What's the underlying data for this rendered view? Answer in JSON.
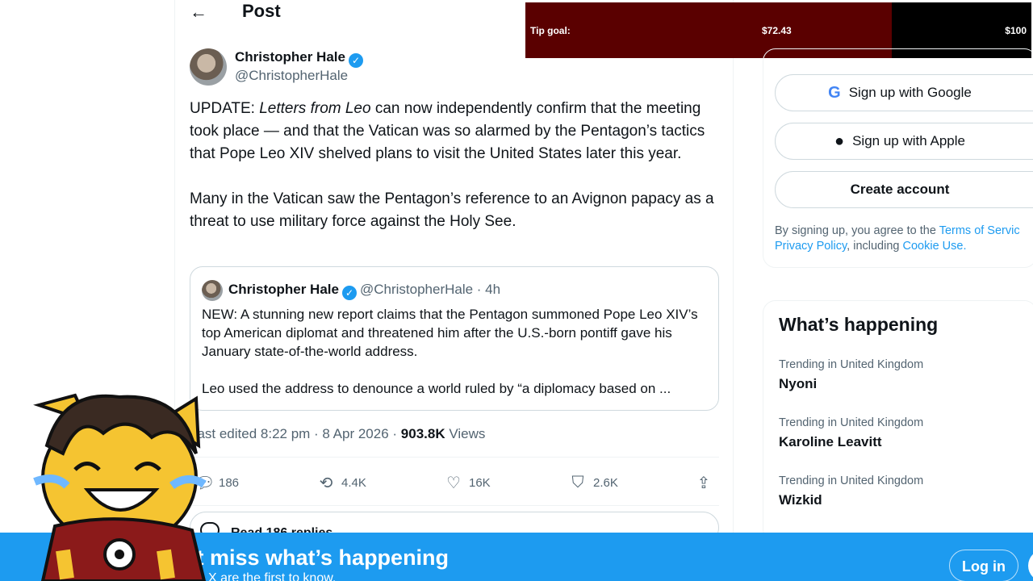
{
  "header": {
    "title": "Post",
    "back_icon": "arrow-left-icon"
  },
  "post": {
    "author_name": "Christopher Hale",
    "author_handle": "@ChristopherHale",
    "text_p1_prefix": "UPDATE: ",
    "text_p1_italic": "Letters from Leo",
    "text_p1_rest": " can now independently confirm that the meeting took place — and that the Vatican was so alarmed by the Pentagon’s tactics that Pope Leo XIV shelved plans to visit the United States later this year.",
    "text_p2": "Many in the Vatican saw the Pentagon’s reference to an Avignon papacy as a threat to use military force against the Holy See.",
    "edited_text": "Last edited 8:22 pm · 8 Apr 2026 · ",
    "views_count": "903.8K",
    "views_label": " Views"
  },
  "quote": {
    "author_name": "Christopher Hale",
    "meta": "@ChristopherHale · 4h",
    "text_p1": "NEW: A stunning new report claims that the Pentagon summoned Pope Leo XIV’s top American diplomat and threatened him after the U.S.-born pontiff gave his January state-of-the-world address.",
    "text_p2": "Leo used the address to denounce a world ruled by “a diplomacy based on ..."
  },
  "actions": {
    "replies": "186",
    "reposts": "4.4K",
    "likes": "16K",
    "bookmarks": "2.6K"
  },
  "read_replies": "Read 186 replies",
  "tip": {
    "label": "Tip goal:",
    "current": "$72.43",
    "goal": "$100",
    "progress": 0.7243,
    "fill_color": "#5a0000"
  },
  "signup": {
    "google": "Sign up with Google",
    "apple": "Sign up with Apple",
    "create": "Create account",
    "legal_1": "By signing up, you agree to the ",
    "terms": "Terms of Servic",
    "privacy": "Privacy Policy",
    "legal_2": ", including ",
    "cookie": "Cookie Use."
  },
  "trends": {
    "title": "What’s happening",
    "items": [
      {
        "context": "Trending in United Kingdom",
        "name": "Nyoni"
      },
      {
        "context": "Trending in United Kingdom",
        "name": "Karoline Leavitt"
      },
      {
        "context": "Trending in United Kingdom",
        "name": "Wizkid"
      }
    ]
  },
  "banner": {
    "title": "’t miss what’s happening",
    "subtitle": "ple on X are the first to know.",
    "login": "Log in"
  },
  "colors": {
    "accent": "#1d9bf0",
    "text": "#0f1419",
    "muted": "#536471"
  }
}
